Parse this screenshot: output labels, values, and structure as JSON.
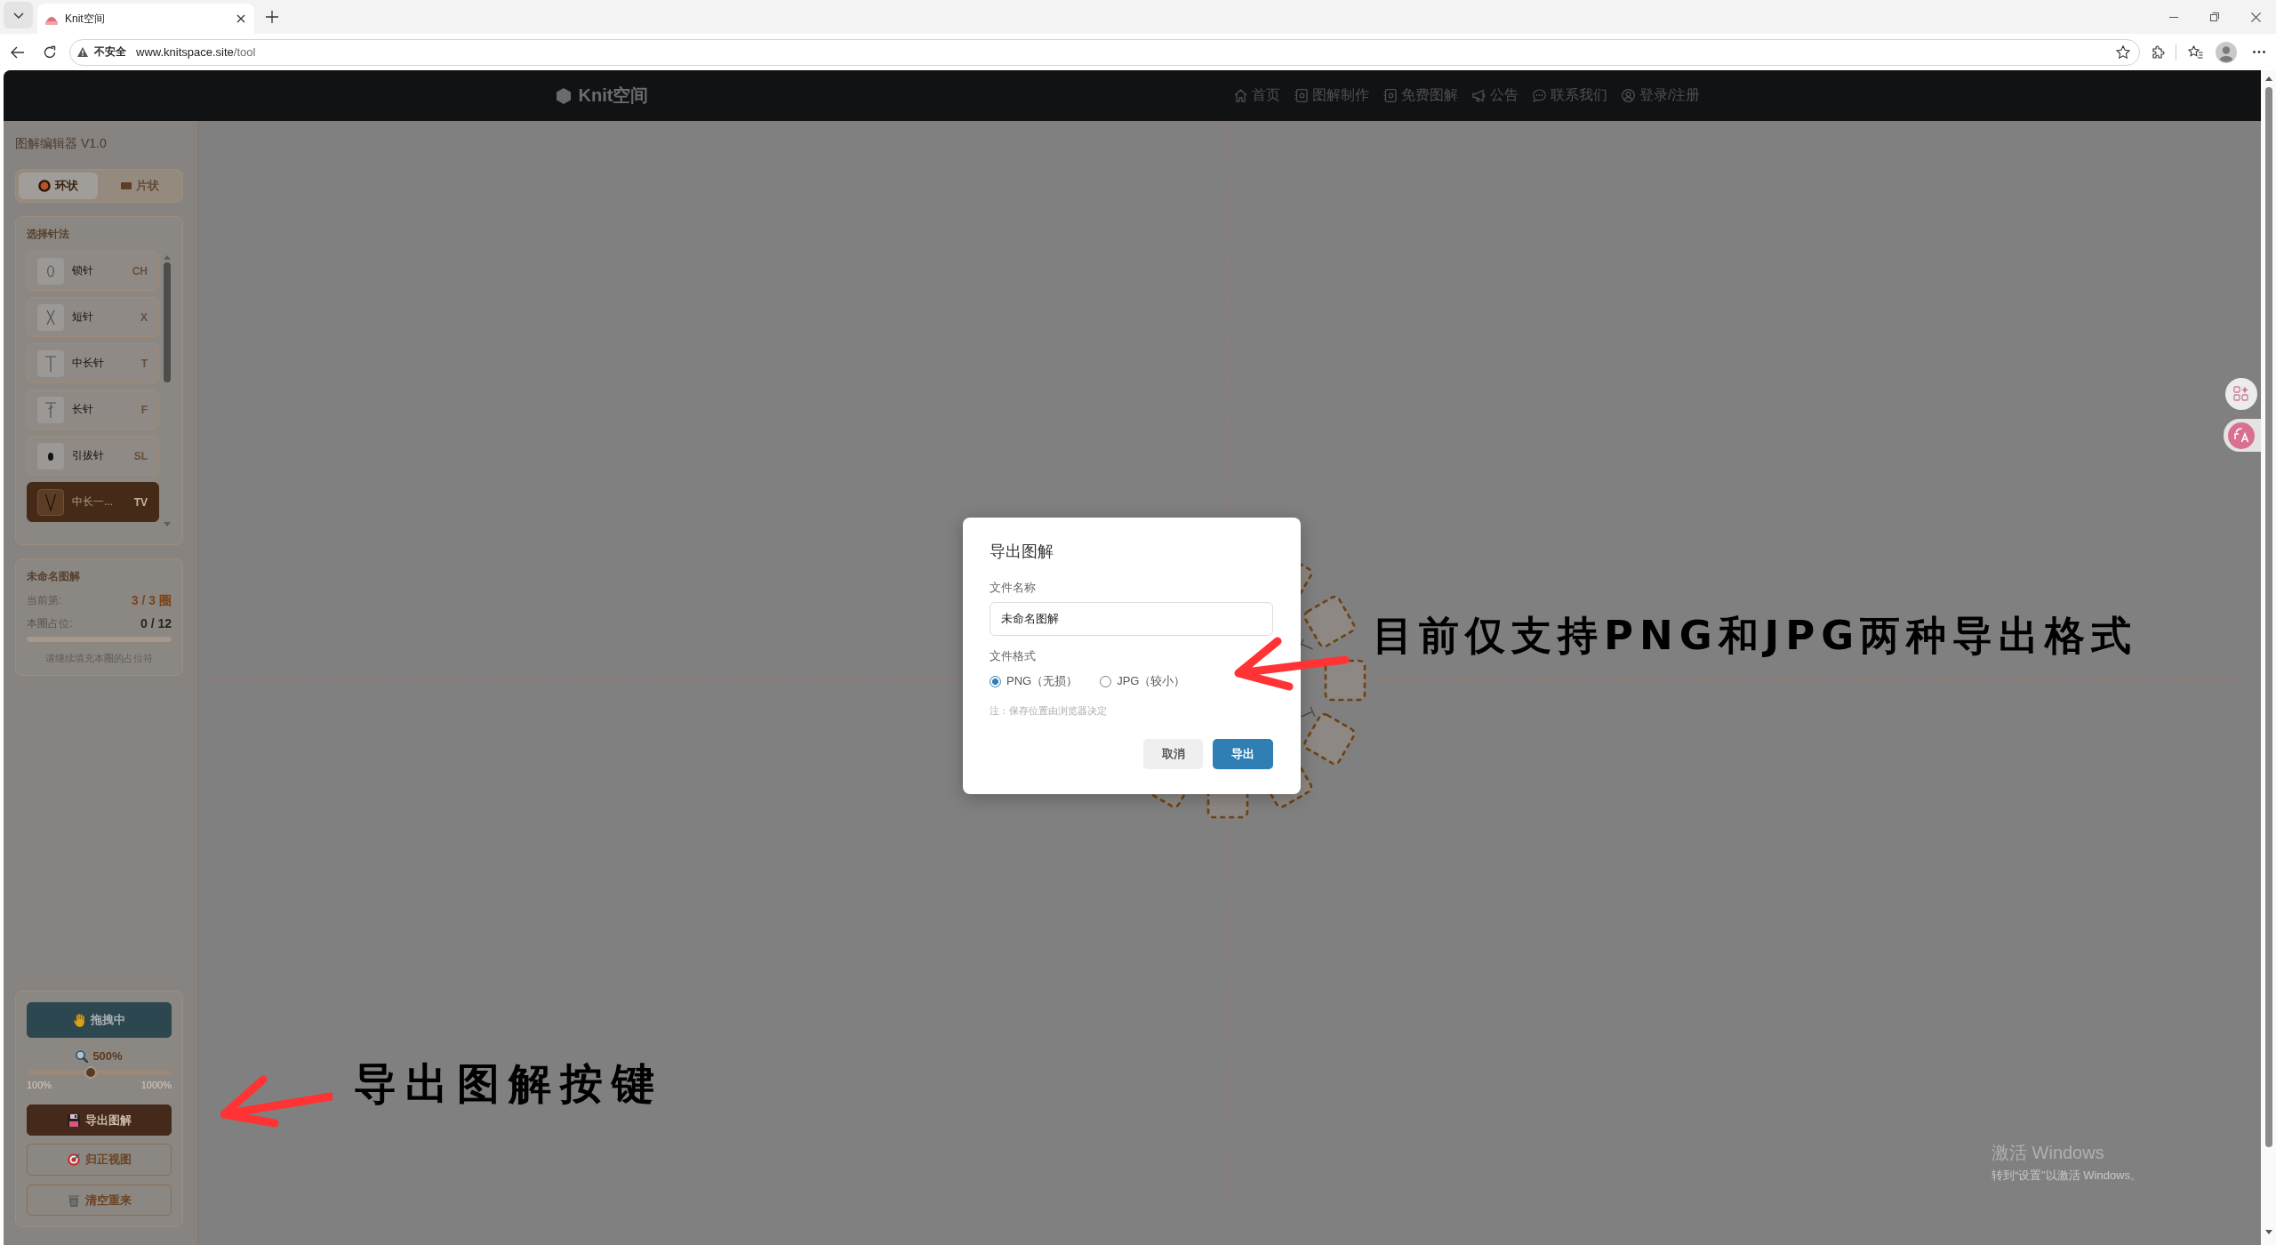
{
  "browser": {
    "tab": {
      "title": "Knit空间"
    },
    "address": {
      "security": "不安全",
      "host": "www.knitspace.site",
      "path": "/tool"
    }
  },
  "header": {
    "logo": "Knit空间",
    "nav": [
      {
        "kind": "home",
        "label": "首页"
      },
      {
        "kind": "chart",
        "label": "图解制作"
      },
      {
        "kind": "chart",
        "label": "免费图解"
      },
      {
        "kind": "notice",
        "label": "公告"
      },
      {
        "kind": "contact",
        "label": "联系我们"
      },
      {
        "kind": "account",
        "label": "登录/注册"
      }
    ]
  },
  "sidebar": {
    "title": "图解编辑器 V1.0",
    "modes": [
      {
        "kind": "ring",
        "label": "环状",
        "selected": true
      },
      {
        "kind": "sheet",
        "label": "片状",
        "selected": false
      }
    ],
    "stitch_panel": {
      "title": "选择针法",
      "stitches": [
        {
          "kind": "chain",
          "name": "锁针",
          "code": "CH",
          "selected": false
        },
        {
          "kind": "cross",
          "name": "短针",
          "code": "X",
          "selected": false
        },
        {
          "kind": "tee",
          "name": "中长针",
          "code": "T",
          "selected": false
        },
        {
          "kind": "slashtee",
          "name": "长针",
          "code": "F",
          "selected": false
        },
        {
          "kind": "dot",
          "name": "引拔针",
          "code": "SL",
          "selected": false
        },
        {
          "kind": "vee",
          "name": "中长一...",
          "code": "TV",
          "selected": true
        }
      ]
    },
    "diagram": {
      "title": "未命名图解",
      "stats": [
        {
          "kind": "accent",
          "label": "当前第:",
          "value": "3 / 3 圈"
        },
        {
          "kind": "plain",
          "label": "本圈占位:",
          "value": "0 / 12"
        }
      ],
      "progress": {
        "level": 0
      },
      "hint": "请继续填充本圈的占位符"
    },
    "tools": {
      "drag": {
        "label": "拖拽中",
        "active": true
      },
      "zoom": {
        "reading": "500%",
        "level": 0.44,
        "min": "100%",
        "max": "1000%"
      },
      "actions": [
        {
          "kind": "export",
          "label": "导出图解"
        },
        {
          "kind": "recenter",
          "label": "归正视图"
        },
        {
          "kind": "clear",
          "label": "清空重来"
        }
      ]
    }
  },
  "dialog": {
    "title": "导出图解",
    "name_label": "文件名称",
    "name_value": "未命名图解",
    "format_label": "文件格式",
    "formats": [
      {
        "label": "PNG（无损）",
        "selected": true
      },
      {
        "label": "JPG（较小）",
        "selected": false
      }
    ],
    "note": "注：保存位置由浏览器决定",
    "buttons": [
      {
        "kind": "secondary",
        "label": "取消"
      },
      {
        "kind": "primary",
        "label": "导出"
      }
    ]
  },
  "annotations": [
    {
      "kind": "bottom",
      "text": "导出图解按键"
    },
    {
      "kind": "right",
      "text": "目前仅支持PNG和JPG两种导出格式"
    }
  ],
  "os_notice": {
    "title": "激活 Windows",
    "hint": "转到“设置”以激活 Windows。"
  }
}
